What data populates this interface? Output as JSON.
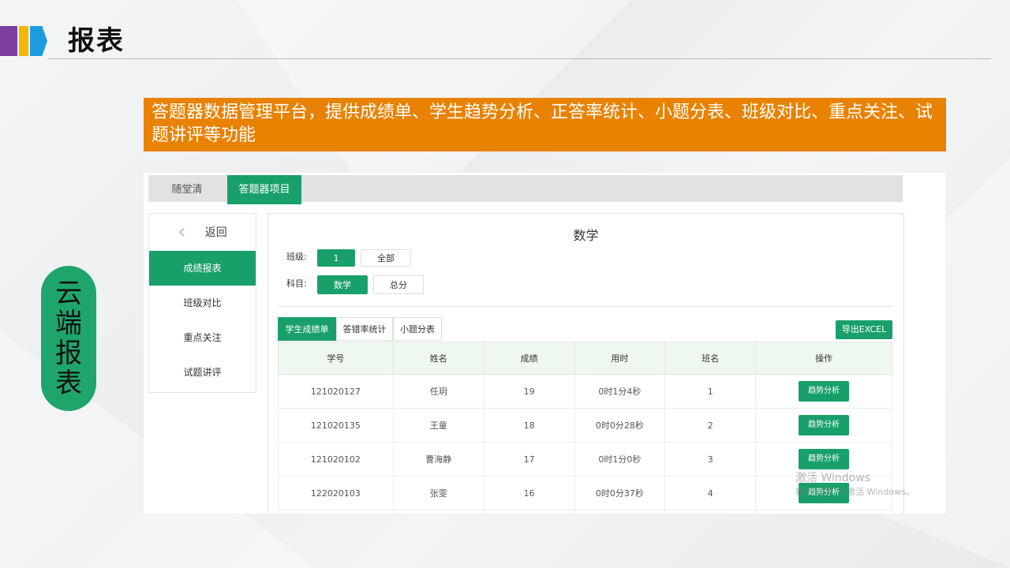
{
  "slide": {
    "title": "报表",
    "banner": "答题器数据管理平台，提供成绩单、学生趋势分析、正答率统计、小题分表、班级对比、重点关注、试题讲评等功能",
    "side_label": [
      "云",
      "端",
      "报",
      "表"
    ]
  },
  "app": {
    "tabs": [
      {
        "label": "随堂清",
        "active": false
      },
      {
        "label": "答题器项目",
        "active": true
      }
    ],
    "sidebar": {
      "back_label": "返回",
      "items": [
        {
          "label": "成绩报表",
          "active": true
        },
        {
          "label": "班级对比",
          "active": false
        },
        {
          "label": "重点关注",
          "active": false
        },
        {
          "label": "试题讲评",
          "active": false
        }
      ]
    },
    "panel": {
      "subject": "数学",
      "class_label": "班级:",
      "class_options": [
        {
          "label": "1",
          "active": true
        },
        {
          "label": "全部",
          "active": false
        }
      ],
      "subject_label": "科目:",
      "subject_options": [
        {
          "label": "数学",
          "active": true
        },
        {
          "label": "总分",
          "active": false
        }
      ],
      "table_tabs": [
        {
          "label": "学生成绩单",
          "active": true
        },
        {
          "label": "答错率统计",
          "active": false
        },
        {
          "label": "小题分表",
          "active": false
        }
      ],
      "export_label": "导出EXCEL",
      "columns": [
        "学号",
        "姓名",
        "成绩",
        "用时",
        "班名",
        "操作"
      ],
      "rows": [
        {
          "id": "121020127",
          "name": "任玥",
          "score": "19",
          "time": "0时1分4秒",
          "rank": "1",
          "action": "趋势分析"
        },
        {
          "id": "121020135",
          "name": "王童",
          "score": "18",
          "time": "0时0分28秒",
          "rank": "2",
          "action": "趋势分析"
        },
        {
          "id": "121020102",
          "name": "曹海静",
          "score": "17",
          "time": "0时1分0秒",
          "rank": "3",
          "action": "趋势分析"
        },
        {
          "id": "122020103",
          "name": "张雯",
          "score": "16",
          "time": "0时0分37秒",
          "rank": "4",
          "action": "趋势分析"
        },
        {
          "id": "",
          "name": "",
          "score": "",
          "time": "",
          "rank": "",
          "action": ""
        }
      ]
    }
  },
  "watermark": {
    "line1": "激活 Windows",
    "line2": "转到\"设置\"以激活 Windows。"
  }
}
